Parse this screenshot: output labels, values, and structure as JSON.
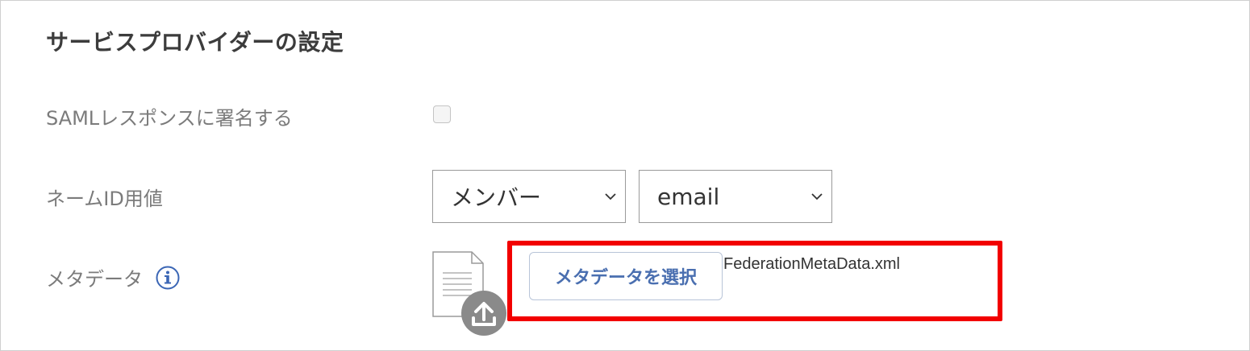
{
  "section": {
    "title": "サービスプロバイダーの設定"
  },
  "sign_response": {
    "label": "SAMLレスポンスに署名する",
    "checked": false
  },
  "name_id": {
    "label": "ネームID用値",
    "type_select": {
      "value": "メンバー"
    },
    "attr_select": {
      "value": "email"
    }
  },
  "metadata": {
    "label": "メタデータ",
    "select_button_label": "メタデータを選択",
    "file_name": "FederationMetaData.xml"
  },
  "colors": {
    "highlight": "#f20000",
    "button_text": "#4a6fb0",
    "info_icon": "#3b66b5",
    "upload_badge": "#8a8a8a"
  }
}
